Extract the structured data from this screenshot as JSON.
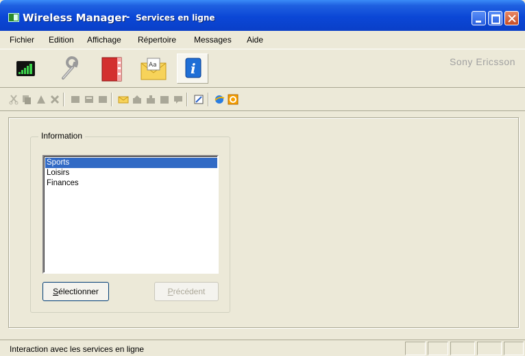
{
  "window": {
    "app_title": "Wireless Manager",
    "separator": "-",
    "page_title": "Services en ligne"
  },
  "menu": {
    "items": [
      "Fichier",
      "Edition",
      "Affichage",
      "Répertoire",
      "Messages",
      "Aide"
    ]
  },
  "toolbar": {
    "brand": "Sony Ericsson",
    "big_buttons": [
      "signal-icon",
      "wrench-icon",
      "phonebook-icon",
      "messages-icon",
      "info-icon"
    ],
    "active_button": "info-icon"
  },
  "panel": {
    "group_label": "Information",
    "list_items": [
      "Sports",
      "Loisirs",
      "Finances"
    ],
    "selected_item": "Sports",
    "select_button": "Sélectionner",
    "previous_button": "Précédent"
  },
  "statusbar": {
    "text": "Interaction avec les services en ligne"
  },
  "colors": {
    "titlebar": "#0b47d6",
    "selection": "#316ac5",
    "face": "#ece9d8"
  }
}
